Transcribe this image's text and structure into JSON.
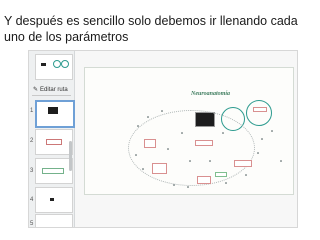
{
  "caption": "Y después es sencillo solo debemos ir llenando cada uno de los parámetros",
  "editor": {
    "edit_path_label": "Editar ruta",
    "slide_numbers": [
      "1",
      "2",
      "3",
      "4",
      "5"
    ],
    "zoom_in_symbol": "+",
    "zoom_out_symbol": "−",
    "pencil_icon": "pencil-icon"
  },
  "canvas": {
    "title": "Neuroanatomía"
  },
  "colors": {
    "accent_teal": "#2d9b8f",
    "label_red": "#c04444",
    "label_green": "#3f8a5a",
    "slide_highlight": "#6fa0d6"
  }
}
